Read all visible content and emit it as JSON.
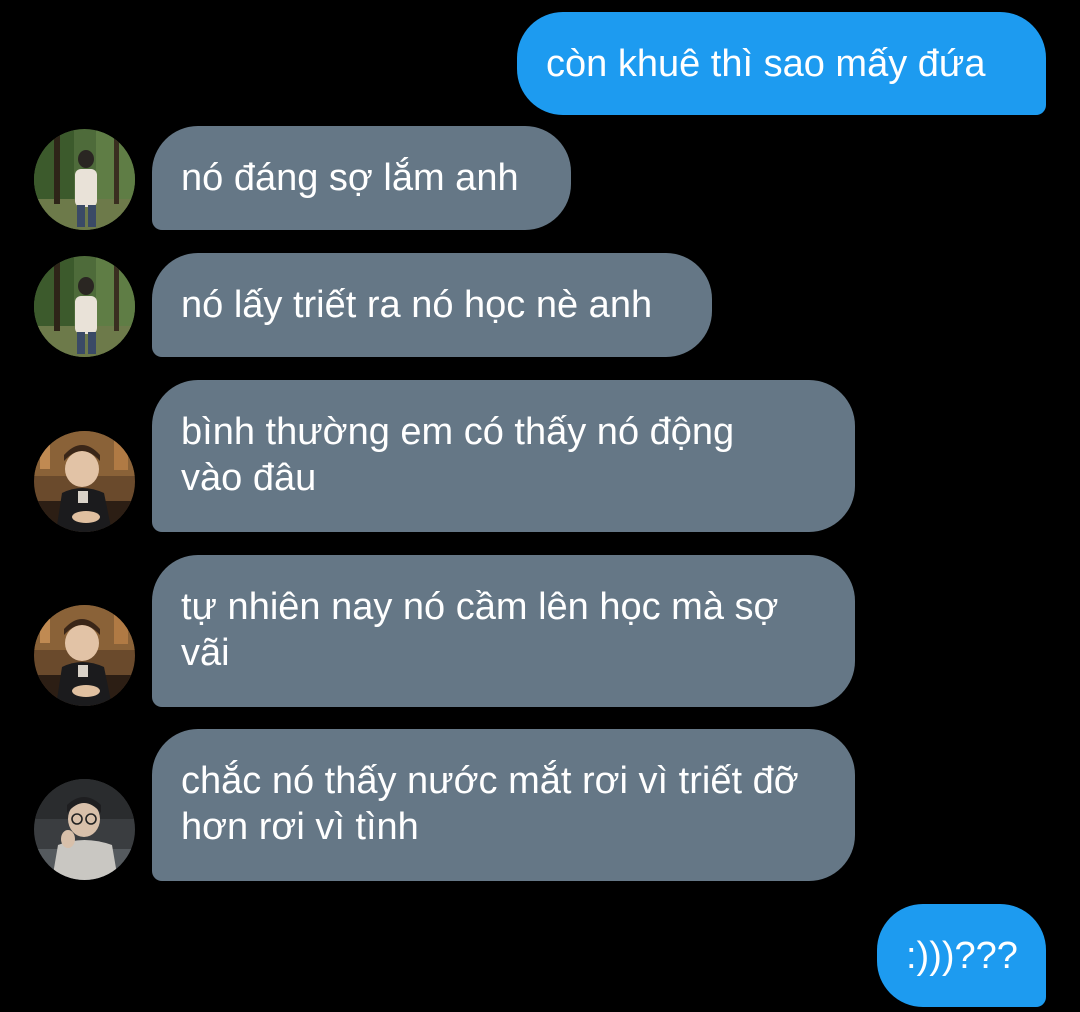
{
  "colors": {
    "background": "#000000",
    "outgoing_bubble": "#1d9bf0",
    "incoming_bubble": "#657786",
    "text": "#ffffff"
  },
  "messages": [
    {
      "direction": "outgoing",
      "text": "còn khuê thì sao mấy đứa"
    },
    {
      "direction": "incoming",
      "avatar": "avatar-photo-park",
      "text": "nó đáng sợ lắm anh"
    },
    {
      "direction": "incoming",
      "avatar": "avatar-photo-park",
      "text": "nó lấy triết ra nó học nè anh"
    },
    {
      "direction": "incoming",
      "avatar": "avatar-photo-bar",
      "text": "bình thường em có thấy nó động vào đâu"
    },
    {
      "direction": "incoming",
      "avatar": "avatar-photo-bar",
      "text": "tự nhiên nay nó cầm lên học mà sợ vãi"
    },
    {
      "direction": "incoming",
      "avatar": "avatar-photo-selfie",
      "text": "chắc nó thấy nước mắt rơi vì triết đỡ hơn rơi vì tình"
    },
    {
      "direction": "outgoing",
      "text": ":)))???"
    }
  ]
}
